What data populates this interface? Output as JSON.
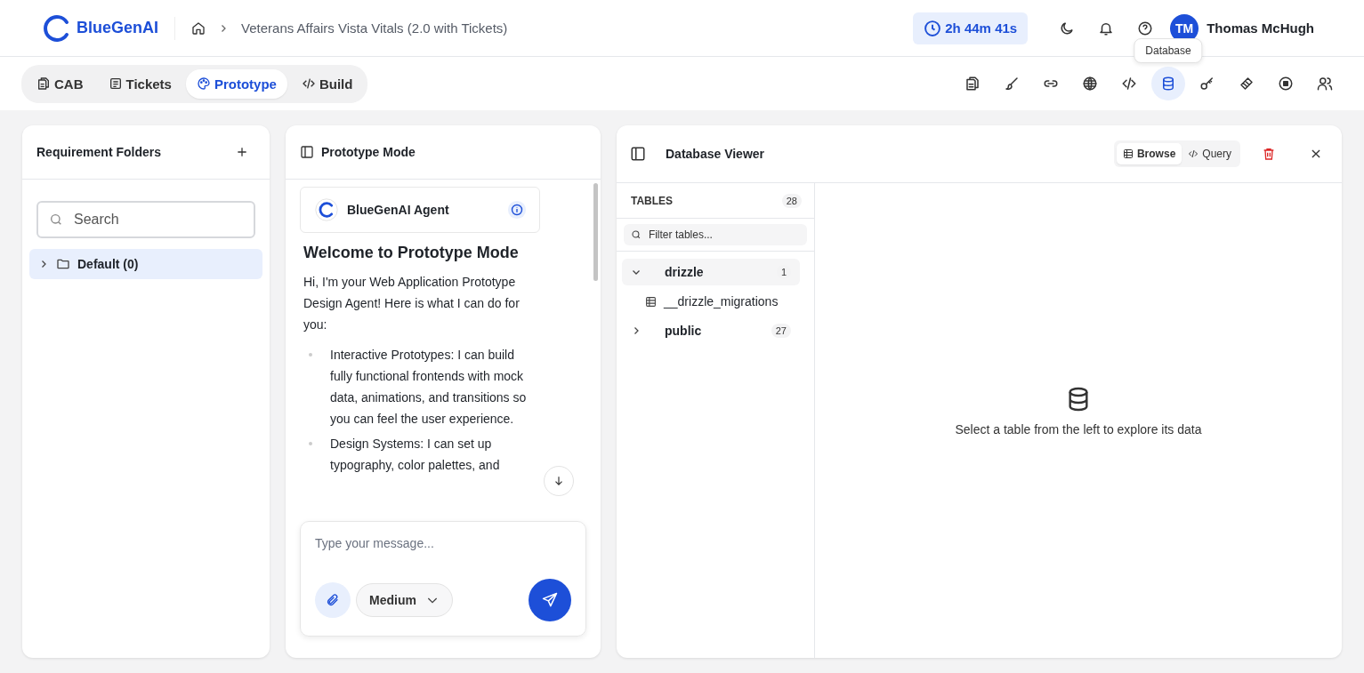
{
  "header": {
    "logo": "BlueGenAI",
    "breadcrumb": "Veterans Affairs Vista Vitals (2.0 with Tickets)",
    "timer": "2h 44m 41s",
    "user": {
      "initials": "TM",
      "name": "Thomas McHugh"
    }
  },
  "tabs": [
    {
      "label": "CAB",
      "selected": false
    },
    {
      "label": "Tickets",
      "selected": false
    },
    {
      "label": "Prototype",
      "selected": true
    },
    {
      "label": "Build",
      "selected": false
    }
  ],
  "toolbar": {
    "tooltip": "Database",
    "items": [
      {
        "selected": false
      },
      {
        "selected": false
      },
      {
        "selected": false
      },
      {
        "selected": false
      },
      {
        "selected": false
      },
      {
        "selected": true
      },
      {
        "selected": false
      },
      {
        "selected": false
      },
      {
        "selected": false
      },
      {
        "selected": false
      }
    ]
  },
  "folders": {
    "title": "Requirement Folders",
    "search_placeholder": "Search",
    "items": [
      {
        "label": "Default (0)",
        "expanded": false,
        "selected": true
      }
    ]
  },
  "chat": {
    "title": "Prototype Mode",
    "agent": "BlueGenAI Agent",
    "heading": "Welcome to Prototype Mode",
    "intro": "Hi, I'm your Web Application Prototype Design Agent! Here is what I can do for you:",
    "bullets": [
      "Interactive Prototypes: I can build fully functional frontends with mock data, animations, and transitions so you can feel the user experience.",
      "Design Systems: I can set up typography, color palettes, and"
    ],
    "input_placeholder": "Type your message...",
    "effort": "Medium"
  },
  "database": {
    "title": "Database Viewer",
    "modes": [
      {
        "label": "Browse",
        "selected": true
      },
      {
        "label": "Query",
        "selected": false
      }
    ],
    "tables_label": "TABLES",
    "tables_count": "28",
    "filter_placeholder": "Filter tables...",
    "schemas": [
      {
        "name": "drizzle",
        "count": "1",
        "expanded": true,
        "children": [
          {
            "name": "__drizzle_migrations"
          }
        ]
      },
      {
        "name": "public",
        "count": "27",
        "expanded": false
      }
    ],
    "empty_message": "Select a table from the left to explore its data"
  }
}
